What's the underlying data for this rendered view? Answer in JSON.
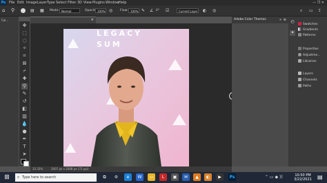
{
  "menubar": {
    "logo": "Ps",
    "items": [
      "File",
      "Edit",
      "Image",
      "Layer",
      "Type",
      "Select",
      "Filter",
      "3D",
      "View",
      "Plugins",
      "Window",
      "Help"
    ]
  },
  "options": {
    "mode_label": "Mode:",
    "mode_value": "Normal",
    "opacity_label": "Opacity:",
    "opacity_value": "100%",
    "flow_label": "Flow:",
    "flow_value": "100%",
    "angle_value": "0°",
    "sample_value": "Current Layer"
  },
  "left_panel": {
    "tab": "Col..."
  },
  "document": {
    "tab_title": "Picture.jpg @ 33.3% (RGB/8#)"
  },
  "status": {
    "zoom": "33.33%",
    "doc_info": "2007 px x 2008 px (72 ppi)"
  },
  "color_themes": {
    "title": "Adobe Color Themes"
  },
  "right_panel": {
    "items": [
      {
        "label": "Swatches",
        "icon": "swatches-icon",
        "color": "#cfcfcf"
      },
      {
        "label": "Gradients",
        "icon": "gradients-icon",
        "color": "#cfcfcf"
      },
      {
        "label": "Patterns",
        "icon": "patterns-icon",
        "color": "#cfcfcf"
      },
      {
        "label": "Properties",
        "icon": "properties-icon",
        "color": "#cfcfcf"
      },
      {
        "label": "Adjustme...",
        "icon": "adjustments-icon",
        "color": "#cfcfcf"
      },
      {
        "label": "Libraries",
        "icon": "libraries-icon",
        "color": "#cfcfcf"
      },
      {
        "label": "Layers",
        "icon": "layers-icon",
        "color": "#cfcfcf"
      },
      {
        "label": "Channels",
        "icon": "channels-icon",
        "color": "#cfcfcf"
      },
      {
        "label": "Paths",
        "icon": "paths-icon",
        "color": "#cfcfcf"
      }
    ]
  },
  "photo": {
    "banner_line1": "LEGACY",
    "banner_line2": "SUM"
  },
  "taskbar": {
    "search_placeholder": "Type here to search",
    "time": "10:50 PM",
    "date": "3/22/2021"
  },
  "colors": {
    "accent": "#31a8ff",
    "taskbar": "#202838"
  }
}
